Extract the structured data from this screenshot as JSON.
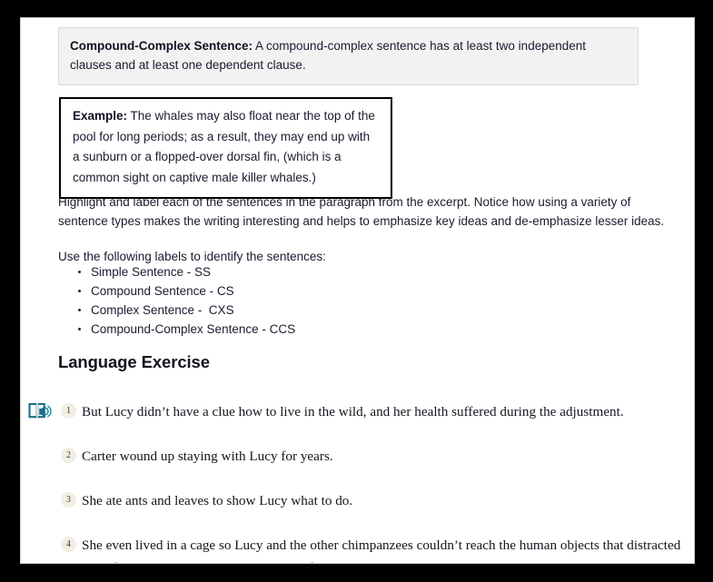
{
  "definition": {
    "label": "Compound-Complex Sentence:",
    "text": " A compound-complex sentence has at least two independent clauses and at least one dependent clause."
  },
  "example": {
    "label": "Example:",
    "text": " The whales may also float near the top of the pool for long periods; as a result, they may end up with a sunburn or a flopped-over dorsal fin, (which is a common sight on captive male killer whales.)"
  },
  "instructions": "Highlight and label each of the sentences in the paragraph from the excerpt. Notice how using a variety of sentence types makes the writing interesting and helps to emphasize key ideas and de-emphasize lesser ideas.",
  "labels_intro": "Use the following labels to identify the sentences:",
  "label_list": [
    "Simple Sentence - SS",
    "Compound Sentence - CS",
    "Complex Sentence -  CXS",
    "Compound-Complex Sentence - CCS"
  ],
  "section_heading": "Language Exercise",
  "exercise": {
    "items": [
      {
        "number": "1",
        "text": "But Lucy didn’t have a clue how to live in the wild, and her health suffered during the adjustment.",
        "has_audio_icon": true
      },
      {
        "number": "2",
        "text": "Carter wound up staying with Lucy for years.",
        "has_audio_icon": false
      },
      {
        "number": "3",
        "text": "She ate ants and leaves to show Lucy what to do.",
        "has_audio_icon": false
      },
      {
        "number": "4",
        "text": "She even lived in a cage so Lucy and the other chimpanzees couldn’t reach the human objects that distracted them from normal activities like seeking food and shelter.",
        "has_audio_icon": false
      }
    ]
  },
  "icons": {
    "read_aloud": "read-aloud-book-speaker-icon"
  },
  "colors": {
    "frame": "#000000",
    "page_background": "#ffffff",
    "definition_background": "#f2f2f2",
    "definition_border": "#d9d9d9",
    "example_border": "#000000",
    "body_text": "#1b1b2f",
    "heading_text": "#141420",
    "icon_accent": "#1a6f85",
    "number_badge_background": "#f1eee4"
  }
}
